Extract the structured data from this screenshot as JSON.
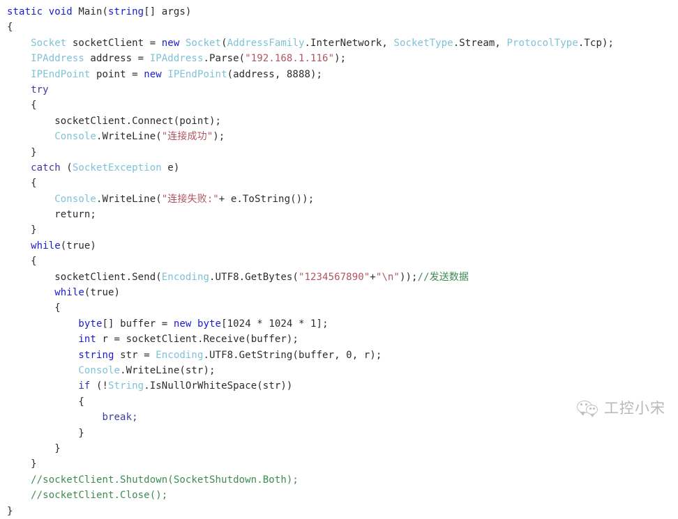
{
  "editor": {
    "language": "csharp",
    "background_color": "#ffffff",
    "colors": {
      "keyword": "#1b1bd0",
      "keyword_control": "#3b3b9e",
      "type": "#7ec2d8",
      "plain": "#2b2b2b",
      "string": "#b0555f",
      "comment": "#3f8a52"
    },
    "lines": [
      {
        "indent": 0,
        "tokens": [
          {
            "t": "static",
            "c": "kw"
          },
          {
            "t": " ",
            "c": "plain"
          },
          {
            "t": "void",
            "c": "kw"
          },
          {
            "t": " Main(",
            "c": "plain"
          },
          {
            "t": "string",
            "c": "kw"
          },
          {
            "t": "[] args)",
            "c": "plain"
          }
        ]
      },
      {
        "indent": 0,
        "tokens": [
          {
            "t": "{",
            "c": "plain"
          }
        ]
      },
      {
        "indent": 1,
        "tokens": [
          {
            "t": "Socket",
            "c": "type"
          },
          {
            "t": " socketClient = ",
            "c": "plain"
          },
          {
            "t": "new",
            "c": "kw"
          },
          {
            "t": " ",
            "c": "plain"
          },
          {
            "t": "Socket",
            "c": "type"
          },
          {
            "t": "(",
            "c": "plain"
          },
          {
            "t": "AddressFamily",
            "c": "type"
          },
          {
            "t": ".InterNetwork, ",
            "c": "plain"
          },
          {
            "t": "SocketType",
            "c": "type"
          },
          {
            "t": ".Stream, ",
            "c": "plain"
          },
          {
            "t": "ProtocolType",
            "c": "type"
          },
          {
            "t": ".Tcp);",
            "c": "plain"
          }
        ]
      },
      {
        "indent": 1,
        "tokens": [
          {
            "t": "IPAddress",
            "c": "type"
          },
          {
            "t": " address = ",
            "c": "plain"
          },
          {
            "t": "IPAddress",
            "c": "type"
          },
          {
            "t": ".Parse(",
            "c": "plain"
          },
          {
            "t": "\"192.168.1.116\"",
            "c": "str"
          },
          {
            "t": ");",
            "c": "plain"
          }
        ]
      },
      {
        "indent": 1,
        "tokens": [
          {
            "t": "IPEndPoint",
            "c": "type"
          },
          {
            "t": " point = ",
            "c": "plain"
          },
          {
            "t": "new",
            "c": "kw"
          },
          {
            "t": " ",
            "c": "plain"
          },
          {
            "t": "IPEndPoint",
            "c": "type"
          },
          {
            "t": "(address, 8888);",
            "c": "plain"
          }
        ]
      },
      {
        "indent": 1,
        "tokens": [
          {
            "t": "try",
            "c": "kw2"
          }
        ]
      },
      {
        "indent": 1,
        "tokens": [
          {
            "t": "{",
            "c": "plain"
          }
        ]
      },
      {
        "indent": 2,
        "tokens": [
          {
            "t": "socketClient.Connect(point);",
            "c": "plain"
          }
        ]
      },
      {
        "indent": 2,
        "tokens": [
          {
            "t": "Console",
            "c": "type"
          },
          {
            "t": ".WriteLine(",
            "c": "plain"
          },
          {
            "t": "\"连接成功\"",
            "c": "str"
          },
          {
            "t": ");",
            "c": "plain"
          }
        ]
      },
      {
        "indent": 1,
        "tokens": [
          {
            "t": "}",
            "c": "plain"
          }
        ]
      },
      {
        "indent": 1,
        "tokens": [
          {
            "t": "catch",
            "c": "kw2"
          },
          {
            "t": " (",
            "c": "plain"
          },
          {
            "t": "SocketException",
            "c": "type"
          },
          {
            "t": " e)",
            "c": "plain"
          }
        ]
      },
      {
        "indent": 1,
        "tokens": [
          {
            "t": "{",
            "c": "plain"
          }
        ]
      },
      {
        "indent": 2,
        "tokens": [
          {
            "t": "Console",
            "c": "type"
          },
          {
            "t": ".WriteLine(",
            "c": "plain"
          },
          {
            "t": "\"连接失败:\"",
            "c": "str"
          },
          {
            "t": "+ e.ToString());",
            "c": "plain"
          }
        ]
      },
      {
        "indent": 2,
        "tokens": [
          {
            "t": "return;",
            "c": "plain"
          }
        ]
      },
      {
        "indent": 1,
        "tokens": [
          {
            "t": "}",
            "c": "plain"
          }
        ]
      },
      {
        "indent": 1,
        "tokens": [
          {
            "t": "while",
            "c": "kw"
          },
          {
            "t": "(true)",
            "c": "plain"
          }
        ]
      },
      {
        "indent": 1,
        "tokens": [
          {
            "t": "{",
            "c": "plain"
          }
        ]
      },
      {
        "indent": 2,
        "tokens": [
          {
            "t": "socketClient.Send(",
            "c": "plain"
          },
          {
            "t": "Encoding",
            "c": "type"
          },
          {
            "t": ".UTF8.GetBytes(",
            "c": "plain"
          },
          {
            "t": "\"1234567890\"",
            "c": "str"
          },
          {
            "t": "+",
            "c": "plain"
          },
          {
            "t": "\"\\n\"",
            "c": "str"
          },
          {
            "t": "));",
            "c": "plain"
          },
          {
            "t": "//发送数据",
            "c": "cmt"
          }
        ]
      },
      {
        "indent": 2,
        "tokens": [
          {
            "t": "while",
            "c": "kw"
          },
          {
            "t": "(true)",
            "c": "plain"
          }
        ]
      },
      {
        "indent": 2,
        "tokens": [
          {
            "t": "{",
            "c": "plain"
          }
        ]
      },
      {
        "indent": 3,
        "tokens": [
          {
            "t": "byte",
            "c": "kw"
          },
          {
            "t": "[] buffer = ",
            "c": "plain"
          },
          {
            "t": "new",
            "c": "kw"
          },
          {
            "t": " ",
            "c": "plain"
          },
          {
            "t": "byte",
            "c": "kw"
          },
          {
            "t": "[1024 * 1024 * 1];",
            "c": "plain"
          }
        ]
      },
      {
        "indent": 3,
        "tokens": [
          {
            "t": "int",
            "c": "kw"
          },
          {
            "t": " r = socketClient.Receive(buffer);",
            "c": "plain"
          }
        ]
      },
      {
        "indent": 3,
        "tokens": [
          {
            "t": "string",
            "c": "kw"
          },
          {
            "t": " str = ",
            "c": "plain"
          },
          {
            "t": "Encoding",
            "c": "type"
          },
          {
            "t": ".UTF8.GetString(buffer, 0, r);",
            "c": "plain"
          }
        ]
      },
      {
        "indent": 3,
        "tokens": [
          {
            "t": "Console",
            "c": "type"
          },
          {
            "t": ".WriteLine(str);",
            "c": "plain"
          }
        ]
      },
      {
        "indent": 3,
        "tokens": [
          {
            "t": "if",
            "c": "kw2"
          },
          {
            "t": " (!",
            "c": "plain"
          },
          {
            "t": "String",
            "c": "type"
          },
          {
            "t": ".IsNullOrWhiteSpace(str))",
            "c": "plain"
          }
        ]
      },
      {
        "indent": 3,
        "tokens": [
          {
            "t": "{",
            "c": "plain"
          }
        ]
      },
      {
        "indent": 4,
        "tokens": [
          {
            "t": "break;",
            "c": "kw2"
          }
        ]
      },
      {
        "indent": 3,
        "tokens": [
          {
            "t": "}",
            "c": "plain"
          }
        ]
      },
      {
        "indent": 2,
        "tokens": [
          {
            "t": "}",
            "c": "plain"
          }
        ]
      },
      {
        "indent": 1,
        "tokens": [
          {
            "t": "}",
            "c": "plain"
          }
        ]
      },
      {
        "indent": 1,
        "tokens": [
          {
            "t": "//socketClient.Shutdown(SocketShutdown.Both);",
            "c": "cmt"
          }
        ]
      },
      {
        "indent": 1,
        "tokens": [
          {
            "t": "//socketClient.Close();",
            "c": "cmt"
          }
        ]
      },
      {
        "indent": 0,
        "tokens": [
          {
            "t": "}",
            "c": "plain"
          }
        ]
      }
    ]
  },
  "watermark": {
    "icon": "wechat-logo-icon",
    "text": "工控小宋",
    "color": "#8d8d8d"
  }
}
